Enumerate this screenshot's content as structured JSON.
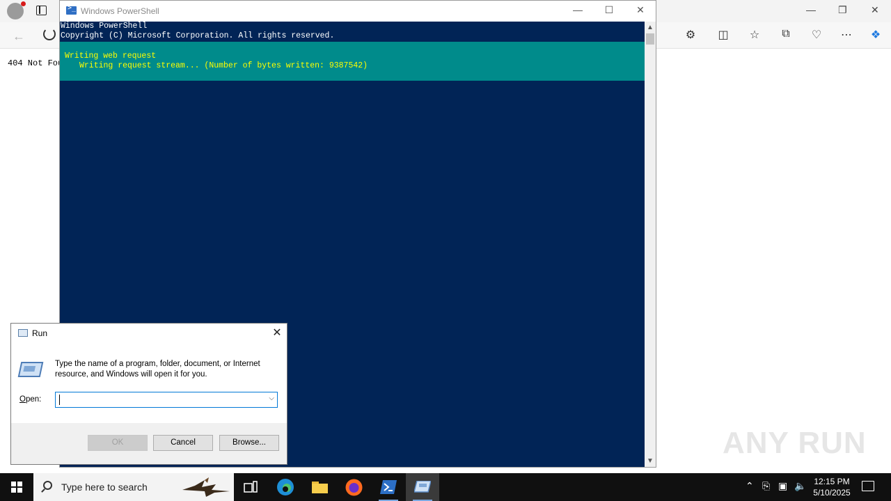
{
  "browser": {
    "page_text": "404 Not Fou",
    "icons": [
      "back-icon",
      "refresh-icon",
      "extensions-icon",
      "split-screen-icon",
      "favorites-icon",
      "collections-icon",
      "performance-icon",
      "more-icon",
      "copilot-icon"
    ]
  },
  "powershell": {
    "title": "Windows PowerShell",
    "lines": [
      "Windows PowerShell",
      "Copyright (C) Microsoft Corporation. All rights reserved."
    ],
    "progress_title": "Writing web request",
    "progress_detail": "Writing request stream... (Number of bytes written: 9387542)",
    "colors": {
      "background": "#012456",
      "progress_band": "#008b8b",
      "progress_text": "#ffff00"
    }
  },
  "run_dialog": {
    "title": "Run",
    "description": "Type the name of a program, folder, document, or Internet resource, and Windows will open it for you.",
    "open_label": "Open:",
    "open_value": "",
    "ok_label": "OK",
    "cancel_label": "Cancel",
    "browse_label": "Browse..."
  },
  "watermark": "ANY RUN",
  "taskbar": {
    "search_placeholder": "Type here to search",
    "apps": [
      "task-view",
      "edge",
      "file-explorer",
      "firefox",
      "powershell",
      "run"
    ],
    "clock_time": "12:15 PM",
    "clock_date": "5/10/2025"
  }
}
